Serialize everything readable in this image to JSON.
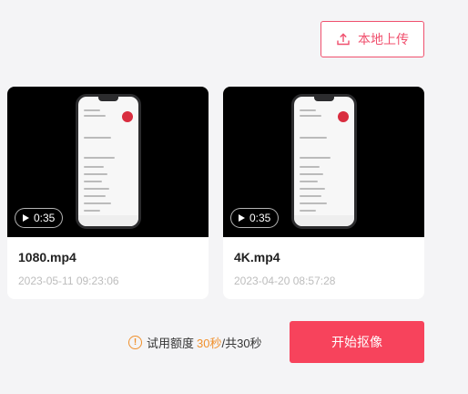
{
  "toolbar": {
    "upload_label": "本地上传",
    "upload_icon": "upload-icon"
  },
  "videos": [
    {
      "name": "1080.mp4",
      "date": "2023-05-11 09:23:06",
      "duration": "0:35"
    },
    {
      "name": "4K.mp4",
      "date": "2023-04-20 08:57:28",
      "duration": "0:35"
    }
  ],
  "quota": {
    "label": "试用额度",
    "used": "30秒",
    "total": "/共30秒",
    "icon": "warning-circle-icon"
  },
  "actions": {
    "start_label": "开始抠像"
  },
  "colors": {
    "accent": "#f7435c",
    "accent_border": "#f0506e",
    "warning": "#f0902d"
  }
}
